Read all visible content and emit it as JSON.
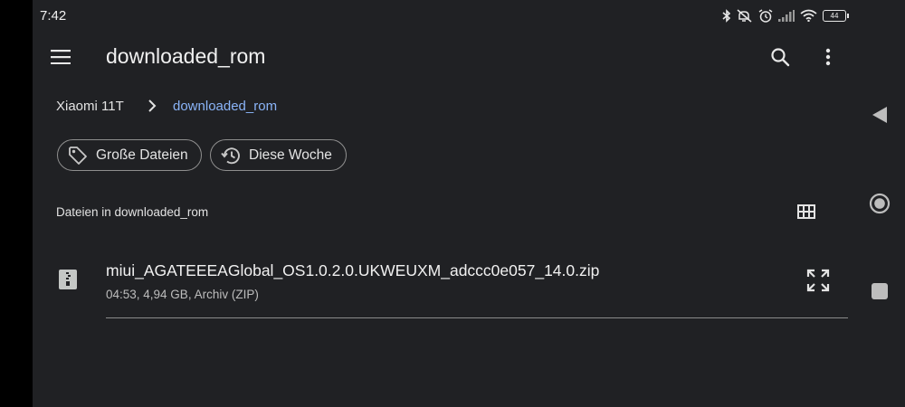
{
  "status_bar": {
    "time": "7:42",
    "battery": "44",
    "icons": [
      "bluetooth-icon",
      "mute-icon",
      "alarm-icon",
      "signal-icon",
      "wifi-icon",
      "battery-icon"
    ]
  },
  "top_bar": {
    "title": "downloaded_rom",
    "menu_icon": "hamburger-menu-icon",
    "search_icon": "search-icon",
    "more_icon": "more-vert-icon"
  },
  "breadcrumb": {
    "items": [
      "Xiaomi 11T",
      "downloaded_rom"
    ],
    "separator_icon": "chevron-right-icon",
    "active_color": "#8ab4f8"
  },
  "chips": [
    {
      "label": "Große Dateien",
      "icon": "tag-icon"
    },
    {
      "label": "Diese Woche",
      "icon": "history-icon"
    }
  ],
  "section": {
    "label": "Dateien in downloaded_rom",
    "view_toggle_icon": "grid-view-icon"
  },
  "files": [
    {
      "name": "miui_AGATEEEAGlobal_OS1.0.2.0.UKWEUXM_adccc0e057_14.0.zip",
      "meta": "04:53, 4,94 GB, Archiv (ZIP)",
      "icon": "zip-archive-icon",
      "action_icon": "expand-icon"
    }
  ],
  "nav_bar": {
    "icons": [
      "back-icon",
      "home-icon",
      "recents-icon"
    ]
  }
}
